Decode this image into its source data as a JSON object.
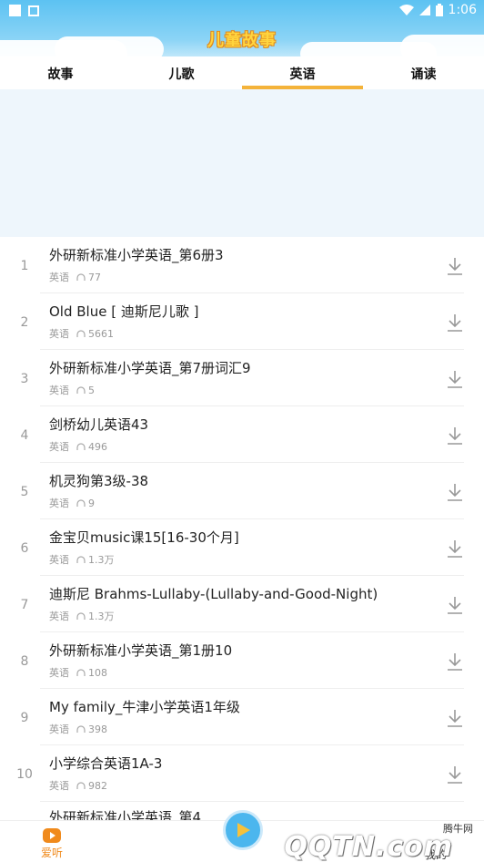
{
  "status_bar": {
    "time": "1:06"
  },
  "header": {
    "title": "儿童故事"
  },
  "tabs": [
    {
      "label": "故事",
      "active": false
    },
    {
      "label": "儿歌",
      "active": false
    },
    {
      "label": "英语",
      "active": true
    },
    {
      "label": "诵读",
      "active": false
    }
  ],
  "list": {
    "items": [
      {
        "index": "1",
        "title": "外研新标准小学英语_第6册3",
        "category": "英语",
        "plays": "77"
      },
      {
        "index": "2",
        "title": "Old Blue [ 迪斯尼儿歌 ]",
        "category": "英语",
        "plays": "5661"
      },
      {
        "index": "3",
        "title": "外研新标准小学英语_第7册词汇9",
        "category": "英语",
        "plays": "5"
      },
      {
        "index": "4",
        "title": "剑桥幼儿英语43",
        "category": "英语",
        "plays": "496"
      },
      {
        "index": "5",
        "title": "机灵狗第3级-38",
        "category": "英语",
        "plays": "9"
      },
      {
        "index": "6",
        "title": "金宝贝music课15[16-30个月]",
        "category": "英语",
        "plays": "1.3万"
      },
      {
        "index": "7",
        "title": "迪斯尼 Brahms-Lullaby-(Lullaby-and-Good-Night)",
        "category": "英语",
        "plays": "1.3万"
      },
      {
        "index": "8",
        "title": "外研新标准小学英语_第1册10",
        "category": "英语",
        "plays": "108"
      },
      {
        "index": "9",
        "title": "My family_牛津小学英语1年级",
        "category": "英语",
        "plays": "398"
      },
      {
        "index": "10",
        "title": "小学综合英语1A-3",
        "category": "英语",
        "plays": "982"
      }
    ],
    "partial_next_title": "外研新标准小学英语_第4"
  },
  "bottom_nav": {
    "left_label": "爱听",
    "right_label": "我的"
  },
  "watermark": {
    "site": "腾牛网",
    "logo": "QQTN.com"
  },
  "colors": {
    "accent": "#f4b33a",
    "sky": "#5cc2f2",
    "active_nav": "#f08a1c"
  }
}
